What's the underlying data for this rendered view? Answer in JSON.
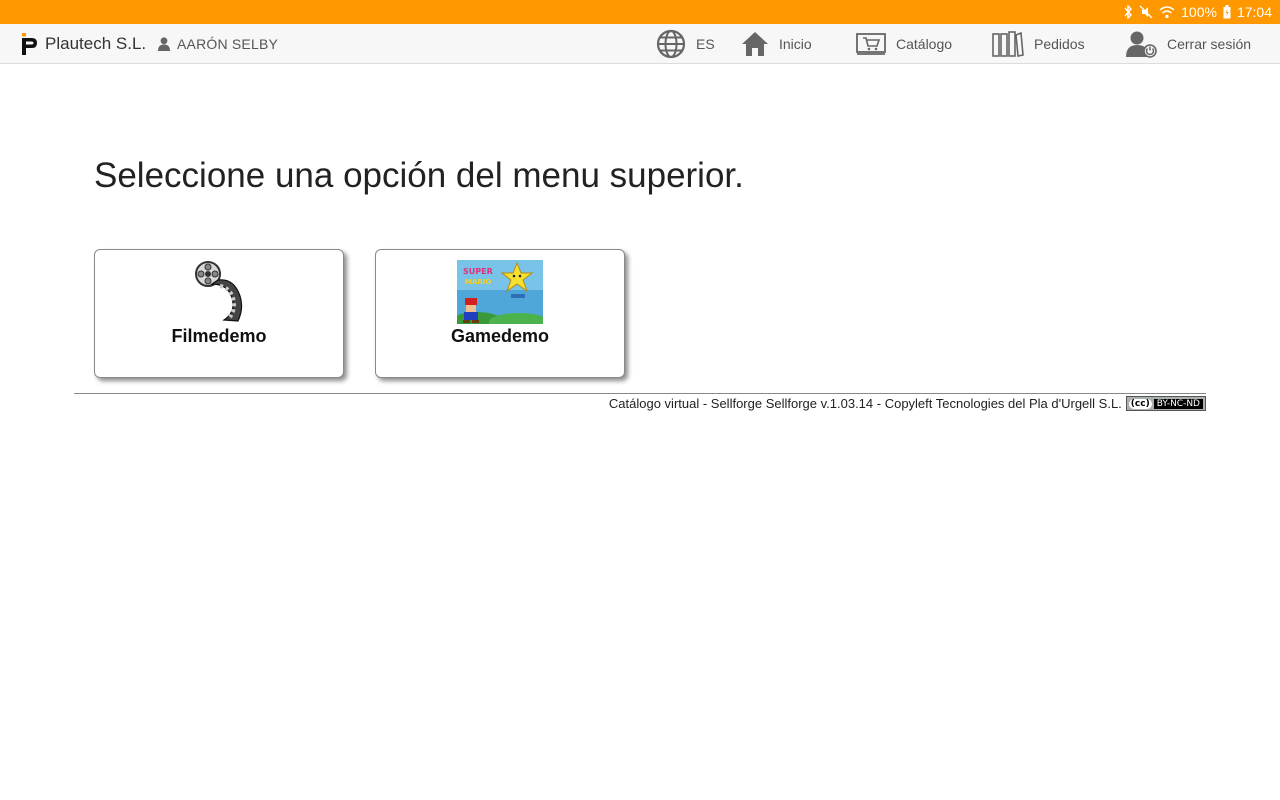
{
  "statusbar": {
    "battery": "100%",
    "time": "17:04",
    "color": "#ff9800"
  },
  "header": {
    "brand": "Plautech S.L.",
    "user": "AARÓN SELBY",
    "nav": {
      "language": "ES",
      "home": "Inicio",
      "catalog": "Catálogo",
      "orders": "Pedidos",
      "logout": "Cerrar sesión"
    }
  },
  "main": {
    "title": "Seleccione una opción del menu superior.",
    "cards": [
      {
        "label": "Filmedemo",
        "icon": "film-reel-icon"
      },
      {
        "label": "Gamedemo",
        "icon": "game-thumbnail"
      }
    ]
  },
  "footer": {
    "text": "Catálogo virtual - Sellforge Sellforge v.1.03.14 - Copyleft Tecnologies del Pla d'Urgell S.L.",
    "license_cc": "(cc)",
    "license_terms": "BY-NC-ND"
  }
}
